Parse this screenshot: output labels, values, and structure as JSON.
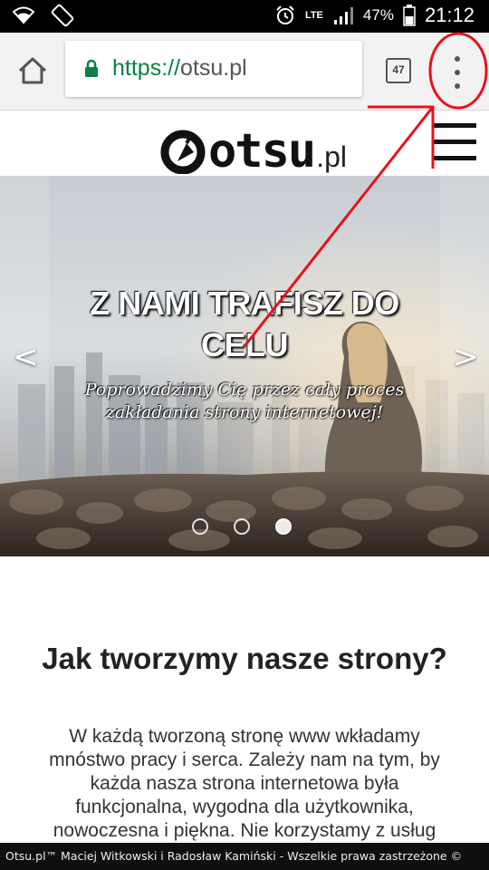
{
  "status_bar": {
    "network": "LTE",
    "battery": "47%",
    "time": "21:12"
  },
  "browser": {
    "url_scheme": "https://",
    "url_host": "otsu.pl",
    "tab_count": "47"
  },
  "site": {
    "logo_text": "otsu",
    "logo_tld": ".pl"
  },
  "hero": {
    "prev": "<",
    "next": ">",
    "title": "Z NAMI TRAFISZ DO CELU",
    "subtitle": "Poprowadzimy Cię przez cały proces zakładania strony internetowej!",
    "slides_total": 3,
    "active_slide": 3
  },
  "content": {
    "heading": "Jak tworzymy nasze strony?",
    "body": "W każdą tworzoną stronę www wkładamy mnóstwo pracy i serca. Zależy nam na tym, by każda nasza strona internetowa była funkcjonalna, wygodna dla użytkownika, nowoczesna i piękna. Nie korzystamy z usług"
  },
  "footer": {
    "text": "Otsu.pl™ Maciej Witkowski i Radosław Kamiński - Wszelkie prawa zastrzeżone ©"
  },
  "colors": {
    "annotation": "#e8111b",
    "secure": "#0b8043",
    "footer_bg": "#0f0f0f"
  },
  "icons": [
    "wifi-icon",
    "screen-rotation-icon",
    "alarm-icon",
    "signal-icon",
    "battery-icon",
    "home-icon",
    "lock-icon",
    "tab-switcher-icon",
    "more-vert-icon",
    "hamburger-icon"
  ]
}
